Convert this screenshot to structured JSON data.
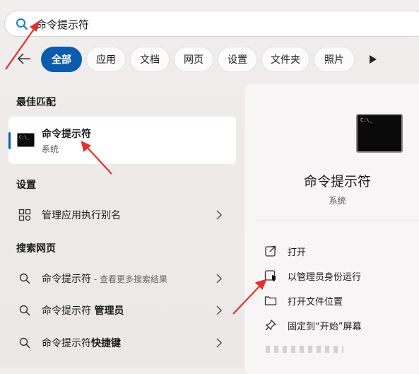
{
  "search": {
    "query": "命令提示符"
  },
  "filters": [
    {
      "label": "全部",
      "active": true
    },
    {
      "label": "应用",
      "active": false
    },
    {
      "label": "文档",
      "active": false
    },
    {
      "label": "网页",
      "active": false
    },
    {
      "label": "设置",
      "active": false
    },
    {
      "label": "文件夹",
      "active": false
    },
    {
      "label": "照片",
      "active": false
    }
  ],
  "left": {
    "best_match_title": "最佳匹配",
    "best_match": {
      "title": "命令提示符",
      "subtitle": "系统"
    },
    "settings_title": "设置",
    "settings_item": "管理应用执行别名",
    "web_title": "搜索网页",
    "web_items": [
      {
        "label": "命令提示符",
        "hint": " - 查看更多搜索结果"
      },
      {
        "label": "命令提示符 ",
        "bold": "管理员"
      },
      {
        "label": "命令提示符",
        "bold": "快捷键"
      }
    ]
  },
  "right": {
    "title": "命令提示符",
    "subtitle": "系统",
    "actions": [
      {
        "label": "打开",
        "icon": "open-external-icon"
      },
      {
        "label": "以管理员身份运行",
        "icon": "shield-admin-icon"
      },
      {
        "label": "打开文件位置",
        "icon": "folder-icon"
      },
      {
        "label": "固定到“开始”屏幕",
        "icon": "pin-icon"
      }
    ]
  },
  "colors": {
    "accent": "#0b5cad",
    "annotation": "#e03030"
  }
}
